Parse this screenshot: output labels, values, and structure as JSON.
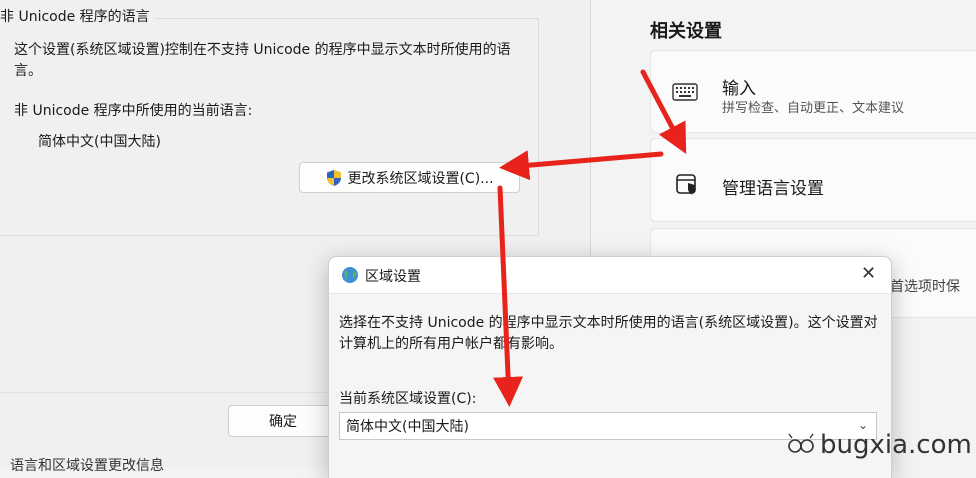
{
  "left_dialog": {
    "group_title": "非 Unicode 程序的语言",
    "description": "这个设置(系统区域设置)控制在不支持 Unicode 的程序中显示文本时所使用的语言。",
    "current_label": "非 Unicode 程序中所使用的当前语言:",
    "current_value": "简体中文(中国大陆)",
    "change_button": "更改系统区域设置(C)...",
    "ok_button": "确定",
    "bottom_partial": "语言和区域设置更改信息"
  },
  "settings": {
    "related_title": "相关设置",
    "input_title": "输入",
    "input_subtitle": "拼写检查、自动更正、文本建议",
    "manage_title": "管理语言设置",
    "third_partial": "言首选项时保"
  },
  "region_dialog": {
    "title": "区域设置",
    "description": "选择在不支持 Unicode 的程序中显示文本时所使用的语言(系统区域设置)。这个设置对计算机上的所有用户帐户都有影响。",
    "current_label": "当前系统区域设置(C):",
    "selected_locale": "简体中文(中国大陆)"
  },
  "watermark": "bugxia.com",
  "colors": {
    "arrow": "#e8231c",
    "shield_blue": "#2b62c4",
    "shield_yellow": "#f2c12e"
  }
}
